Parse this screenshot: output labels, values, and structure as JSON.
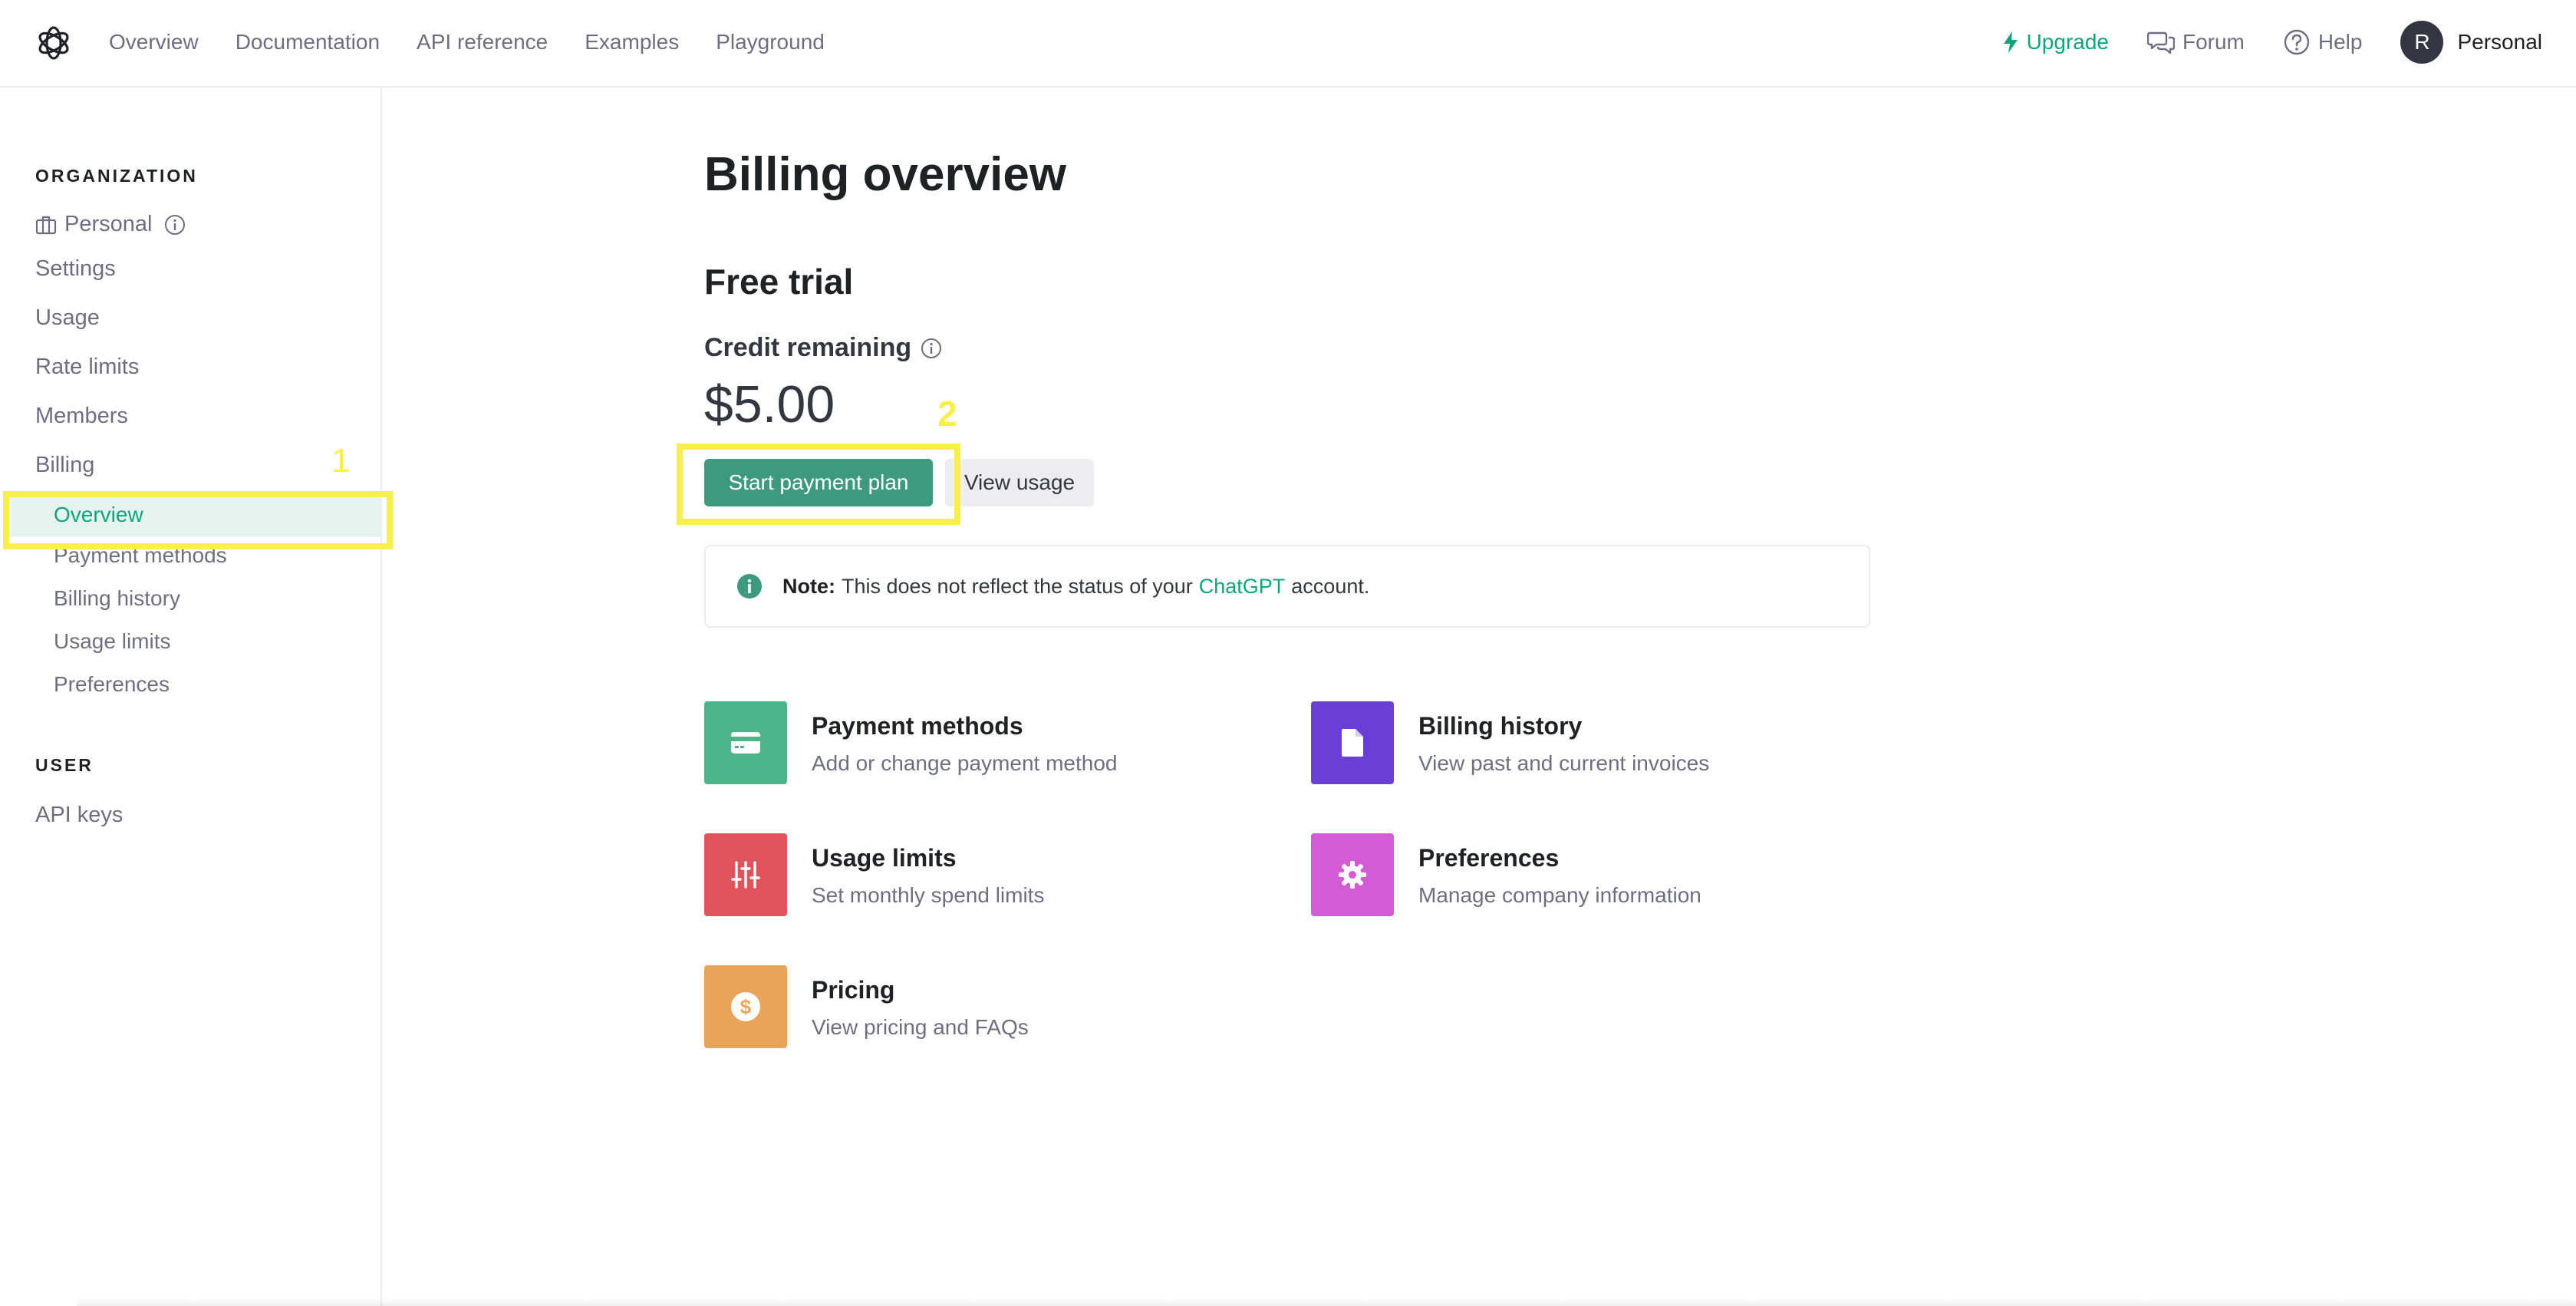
{
  "topbar": {
    "nav": [
      "Overview",
      "Documentation",
      "API reference",
      "Examples",
      "Playground"
    ],
    "upgrade": "Upgrade",
    "forum": "Forum",
    "help": "Help",
    "avatar_initial": "R",
    "account": "Personal"
  },
  "sidebar": {
    "org_heading": "ORGANIZATION",
    "org_name": "Personal",
    "items": [
      "Settings",
      "Usage",
      "Rate limits",
      "Members",
      "Billing"
    ],
    "billing_sub": [
      "Overview",
      "Payment methods",
      "Billing history",
      "Usage limits",
      "Preferences"
    ],
    "active_sub": "Overview",
    "user_heading": "USER",
    "user_items": [
      "API keys"
    ]
  },
  "annotations": {
    "marker_1": "1",
    "marker_2": "2",
    "highlight_color": "#f7ef4a"
  },
  "main": {
    "title": "Billing overview",
    "plan": "Free trial",
    "credit_label": "Credit remaining",
    "credit_amount": "$5.00",
    "start_button": "Start payment plan",
    "view_usage_button": "View usage",
    "note": {
      "label": "Note:",
      "text_before": "This does not reflect the status of your",
      "link": "ChatGPT",
      "text_after": "account."
    },
    "cards": [
      {
        "title": "Payment methods",
        "desc": "Add or change payment method",
        "icon": "credit-card-icon",
        "color": "#4db48a"
      },
      {
        "title": "Billing history",
        "desc": "View past and current invoices",
        "icon": "document-icon",
        "color": "#6a3fd6"
      },
      {
        "title": "Usage limits",
        "desc": "Set monthly spend limits",
        "icon": "sliders-icon",
        "color": "#e0535c"
      },
      {
        "title": "Preferences",
        "desc": "Manage company information",
        "icon": "gear-icon",
        "color": "#d35bd3"
      },
      {
        "title": "Pricing",
        "desc": "View pricing and FAQs",
        "icon": "dollar-icon",
        "color": "#e8a55a"
      }
    ]
  },
  "colors": {
    "accent": "#10a37f",
    "primary_button": "#3d9a7d",
    "active_bg": "#e6f3ef"
  }
}
